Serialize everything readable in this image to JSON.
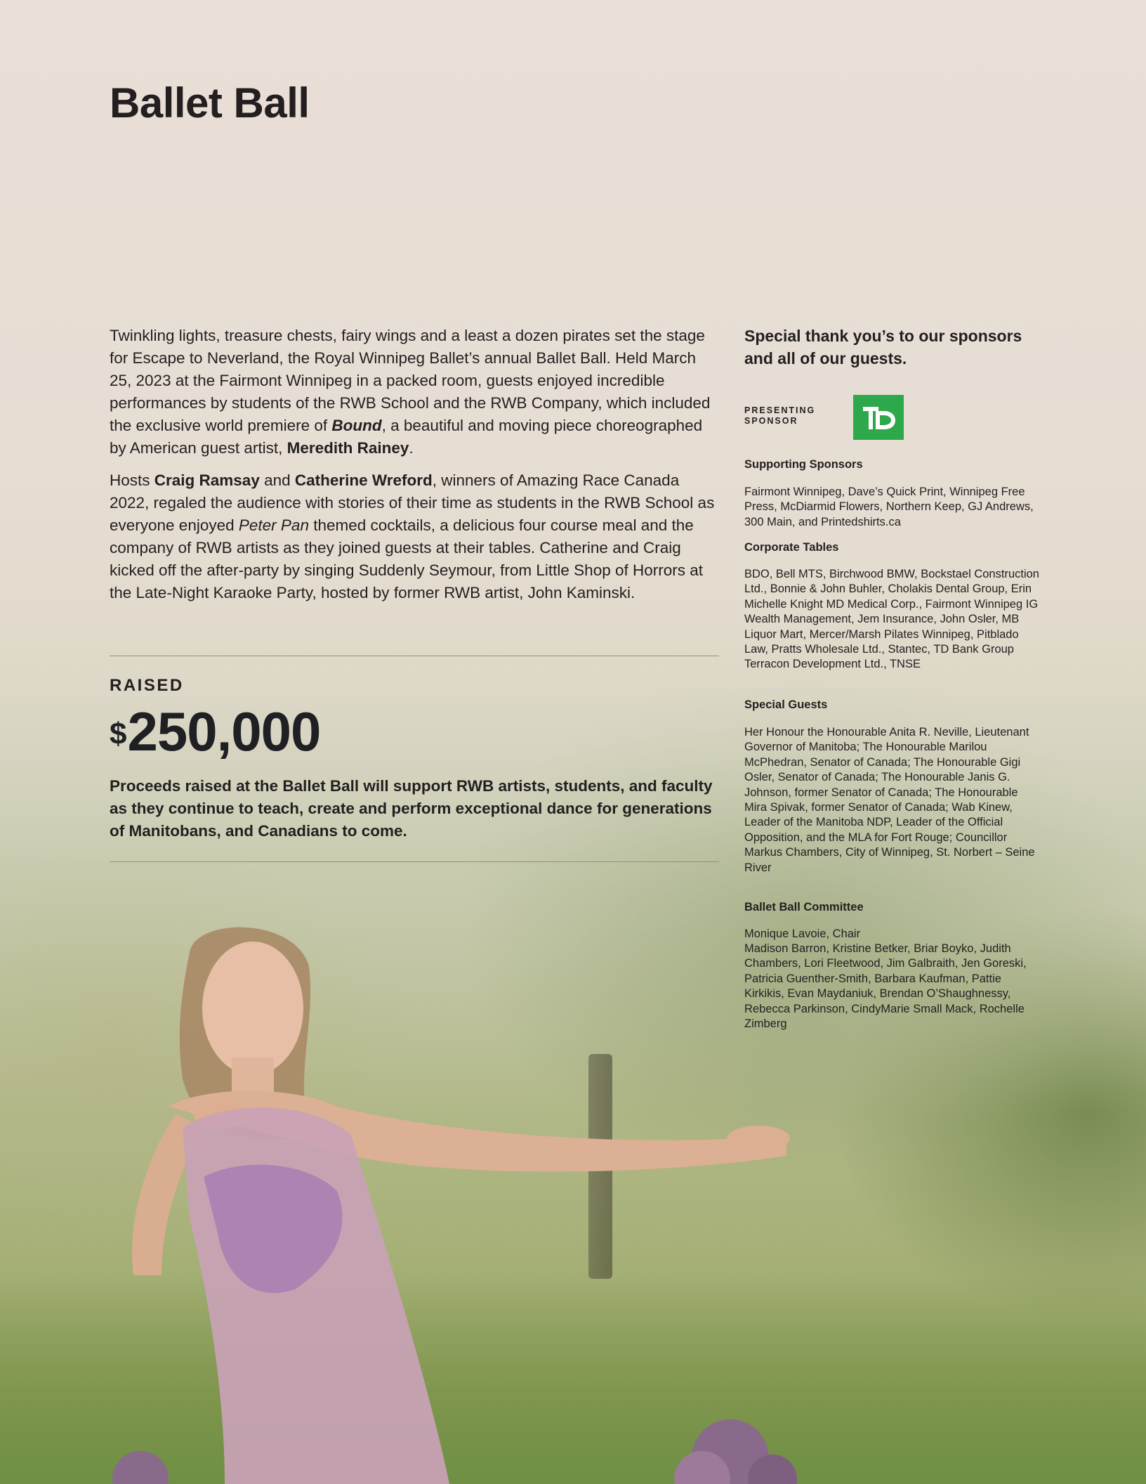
{
  "title": "Ballet Ball",
  "intro": {
    "p1_a": "Twinkling lights, treasure chests, fairy wings and a least a dozen pirates set the stage for Escape to Neverland, the Royal Winnipeg Ballet’s annual Ballet Ball. Held March 25, 2023 at the Fairmont Winnipeg in a packed room, guests enjoyed incredible performances by students of the RWB School and the RWB Company, which included the exclusive world premiere of ",
    "p1_bound": "Bound",
    "p1_b": ", a beautiful and moving piece choreographed by American guest artist, ",
    "p1_artist": "Meredith Rainey",
    "p1_c": ".",
    "p2_a": "Hosts ",
    "p2_host1": "Craig Ramsay",
    "p2_and": " and ",
    "p2_host2": "Catherine Wreford",
    "p2_b": ", winners of Amazing Race Canada 2022, regaled the audience with stories of their time as students in the RWB School as everyone enjoyed ",
    "p2_peter": "Peter Pan",
    "p2_c": " themed cocktails, a delicious four course meal and the company of RWB artists as they joined guests at their tables. Catherine and Craig kicked off the after-party by singing Suddenly Seymour, from Little Shop of Horrors at the Late-Night Karaoke Party, hosted by former RWB artist, John Kaminski."
  },
  "raised": {
    "label": "RAISED",
    "currency": "$",
    "amount": "250,000",
    "proceeds": "Proceeds raised at the Ballet Ball will support RWB artists, students, and faculty as they continue to teach, create and perform exceptional dance for generations of Manitobans, and Canadians to come."
  },
  "sidebar": {
    "thanks": "Special thank you’s to our sponsors and all of our guests.",
    "presenting_label_1": "PRESENTING",
    "presenting_label_2": "SPONSOR",
    "presenting_logo_text": "TD",
    "supporting_heading": "Supporting Sponsors",
    "supporting_body": "Fairmont Winnipeg, Dave’s Quick Print, Winnipeg Free Press, McDiarmid Flowers, Northern Keep, GJ Andrews, 300 Main, and Printedshirts.ca",
    "corporate_heading": "Corporate Tables",
    "corporate_body": "BDO, Bell MTS, Birchwood BMW, Bockstael Construction Ltd., Bonnie & John Buhler, Cholakis Dental Group, Erin Michelle Knight MD Medical Corp., Fairmont Winnipeg IG Wealth Management, Jem Insurance, John Osler, MB Liquor Mart, Mercer/Marsh Pilates Winnipeg, Pitblado Law, Pratts Wholesale Ltd., Stantec, TD Bank Group Terracon Development Ltd., TNSE",
    "guests_heading": "Special Guests",
    "guests_body": "Her Honour the Honourable Anita R. Neville, Lieutenant Governor of Manitoba; The Honourable Marilou McPhedran, Senator of Canada; The Honourable Gigi Osler, Senator of Canada; The Honourable Janis G. Johnson, former Senator of Canada; The Honourable Mira Spivak, former Senator of Canada; Wab Kinew, Leader of the Manitoba NDP, Leader of the Official Opposition, and the MLA for Fort Rouge; Councillor Markus Chambers, City of Winnipeg, St. Norbert – Seine River",
    "committee_heading": "Ballet Ball Committee",
    "committee_chair": "Monique Lavoie, Chair",
    "committee_body": "Madison Barron, Kristine Betker, Briar Boyko, Judith Chambers, Lori Fleetwood, Jim Galbraith, Jen Goreski, Patricia Guenther-Smith, Barbara Kaufman, Pattie Kirkikis, Evan Maydaniuk, Brendan O’Shaughnessy, Rebecca Parkinson, CindyMarie Small Mack, Rochelle Zimberg"
  },
  "colors": {
    "background": "#e8dfd6",
    "text": "#231f20",
    "rule": "#9a8f6f",
    "td_green": "#2da84a"
  }
}
